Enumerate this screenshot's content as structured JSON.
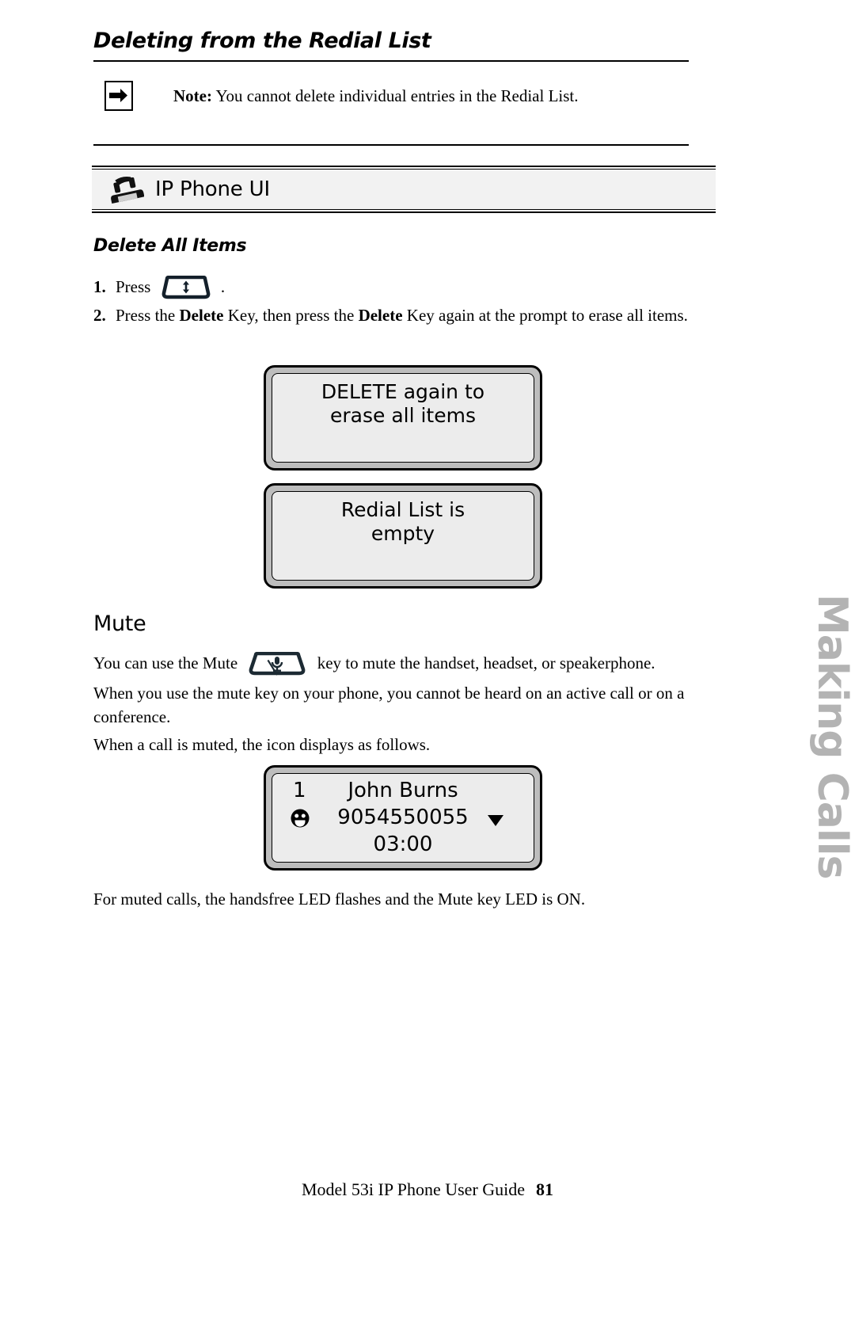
{
  "page": {
    "chapter_title": "Deleting from the Redial List",
    "side_tab_label": "Making Calls",
    "footer_text": "Model 53i IP Phone User Guide",
    "footer_page_number": "81"
  },
  "note": {
    "icon": "arrow-right-icon",
    "label": "Note:",
    "text": "You cannot delete individual entries in the Redial List."
  },
  "ui_banner": {
    "icon": "desk-phone-icon",
    "label": "IP Phone UI",
    "background_color": "#f2f2f2"
  },
  "delete_all_items": {
    "heading": "Delete All Items",
    "steps": [
      {
        "number": "1.",
        "text_before": "Press",
        "key_icon": "redial-key-icon",
        "text_after": "."
      },
      {
        "number": "2.",
        "segments": [
          {
            "text": "Press the ",
            "bold": false
          },
          {
            "text": "Delete",
            "bold": true
          },
          {
            "text": " Key, then press the ",
            "bold": false
          },
          {
            "text": "Delete",
            "bold": true
          },
          {
            "text": " Key again at the prompt to erase all items.",
            "bold": false
          }
        ]
      }
    ],
    "screens": [
      {
        "line1": "DELETE again to",
        "line2": "erase all items"
      },
      {
        "line1": "Redial List is",
        "line2": "empty"
      }
    ]
  },
  "mute": {
    "heading": "Mute",
    "paragraph1_before": "You can use the Mute",
    "paragraph1_key_icon": "mute-key-icon",
    "paragraph1_after": "key to mute the handset, headset, or speakerphone.",
    "paragraph2": "When you use the mute key on your phone, you cannot be heard on an active call or on a conference.",
    "paragraph3": "When a call is muted, the icon displays as follows.",
    "call_screen": {
      "line_index": "1",
      "caller_name": "John Burns",
      "caller_number": "9054550055",
      "duration": "03:00",
      "mute_indicator_icon": "muted-face-icon",
      "scroll_icon": "down-triangle-icon"
    },
    "paragraph4": "For muted calls, the handsfree LED flashes and the Mute key LED is ON."
  },
  "colors": {
    "lcd_bezel": "#bdbdbd",
    "lcd_screen": "#ececec",
    "banner_bg": "#f2f2f2",
    "side_tab": "#b3b3b3"
  }
}
